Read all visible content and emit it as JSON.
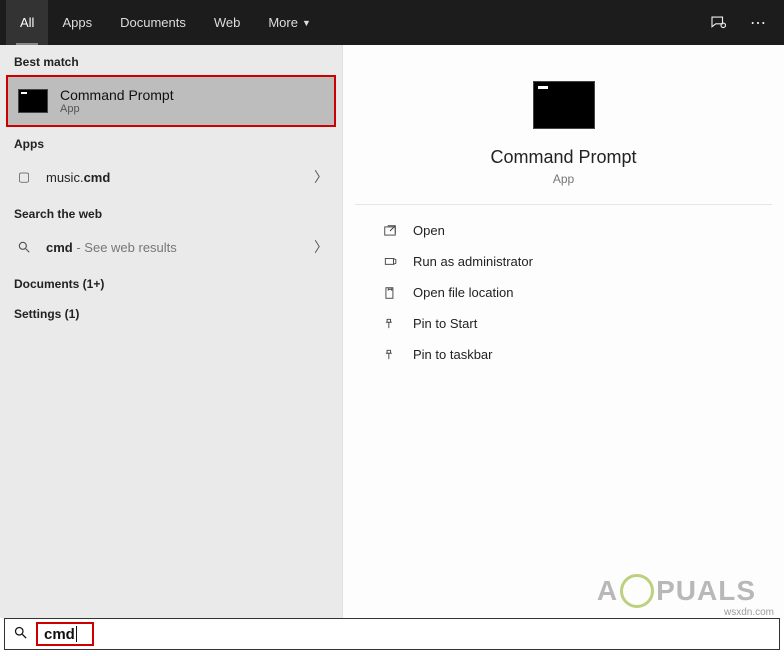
{
  "tabs": {
    "all": "All",
    "apps": "Apps",
    "documents": "Documents",
    "web": "Web",
    "more": "More"
  },
  "left": {
    "best_match_label": "Best match",
    "best_match": {
      "title": "Command Prompt",
      "subtitle": "App"
    },
    "apps_label": "Apps",
    "apps_item_prefix": "music.",
    "apps_item_bold": "cmd",
    "search_web_label": "Search the web",
    "web_item_bold": "cmd",
    "web_item_suffix": " - See web results",
    "documents_label": "Documents (1+)",
    "settings_label": "Settings (1)"
  },
  "preview": {
    "title": "Command Prompt",
    "subtitle": "App",
    "actions": {
      "open": "Open",
      "run_admin": "Run as administrator",
      "open_loc": "Open file location",
      "pin_start": "Pin to Start",
      "pin_taskbar": "Pin to taskbar"
    }
  },
  "search": {
    "query": "cmd"
  },
  "watermark": {
    "text": "A  PUALS",
    "credit": "wsxdn.com"
  }
}
